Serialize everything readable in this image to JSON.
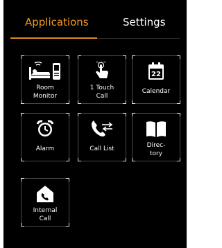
{
  "tabs": [
    {
      "label": "Applications",
      "active": true
    },
    {
      "label": "Settings",
      "active": false
    }
  ],
  "accent_color": "#f39a1c",
  "apps": [
    {
      "label_line1": "Room",
      "label_line2": "Monitor",
      "icon": "room-monitor-icon"
    },
    {
      "label_line1": "1 Touch",
      "label_line2": "Call",
      "icon": "one-touch-call-icon"
    },
    {
      "label_line1": "Calendar",
      "label_line2": "",
      "icon": "calendar-icon",
      "calendar_day": "22"
    },
    {
      "label_line1": "Alarm",
      "label_line2": "",
      "icon": "alarm-clock-icon"
    },
    {
      "label_line1": "Call List",
      "label_line2": "",
      "icon": "call-list-icon"
    },
    {
      "label_line1": "Direc-",
      "label_line2": "tory",
      "icon": "directory-book-icon"
    },
    {
      "label_line1": "Internal",
      "label_line2": "Call",
      "icon": "internal-call-icon"
    }
  ]
}
